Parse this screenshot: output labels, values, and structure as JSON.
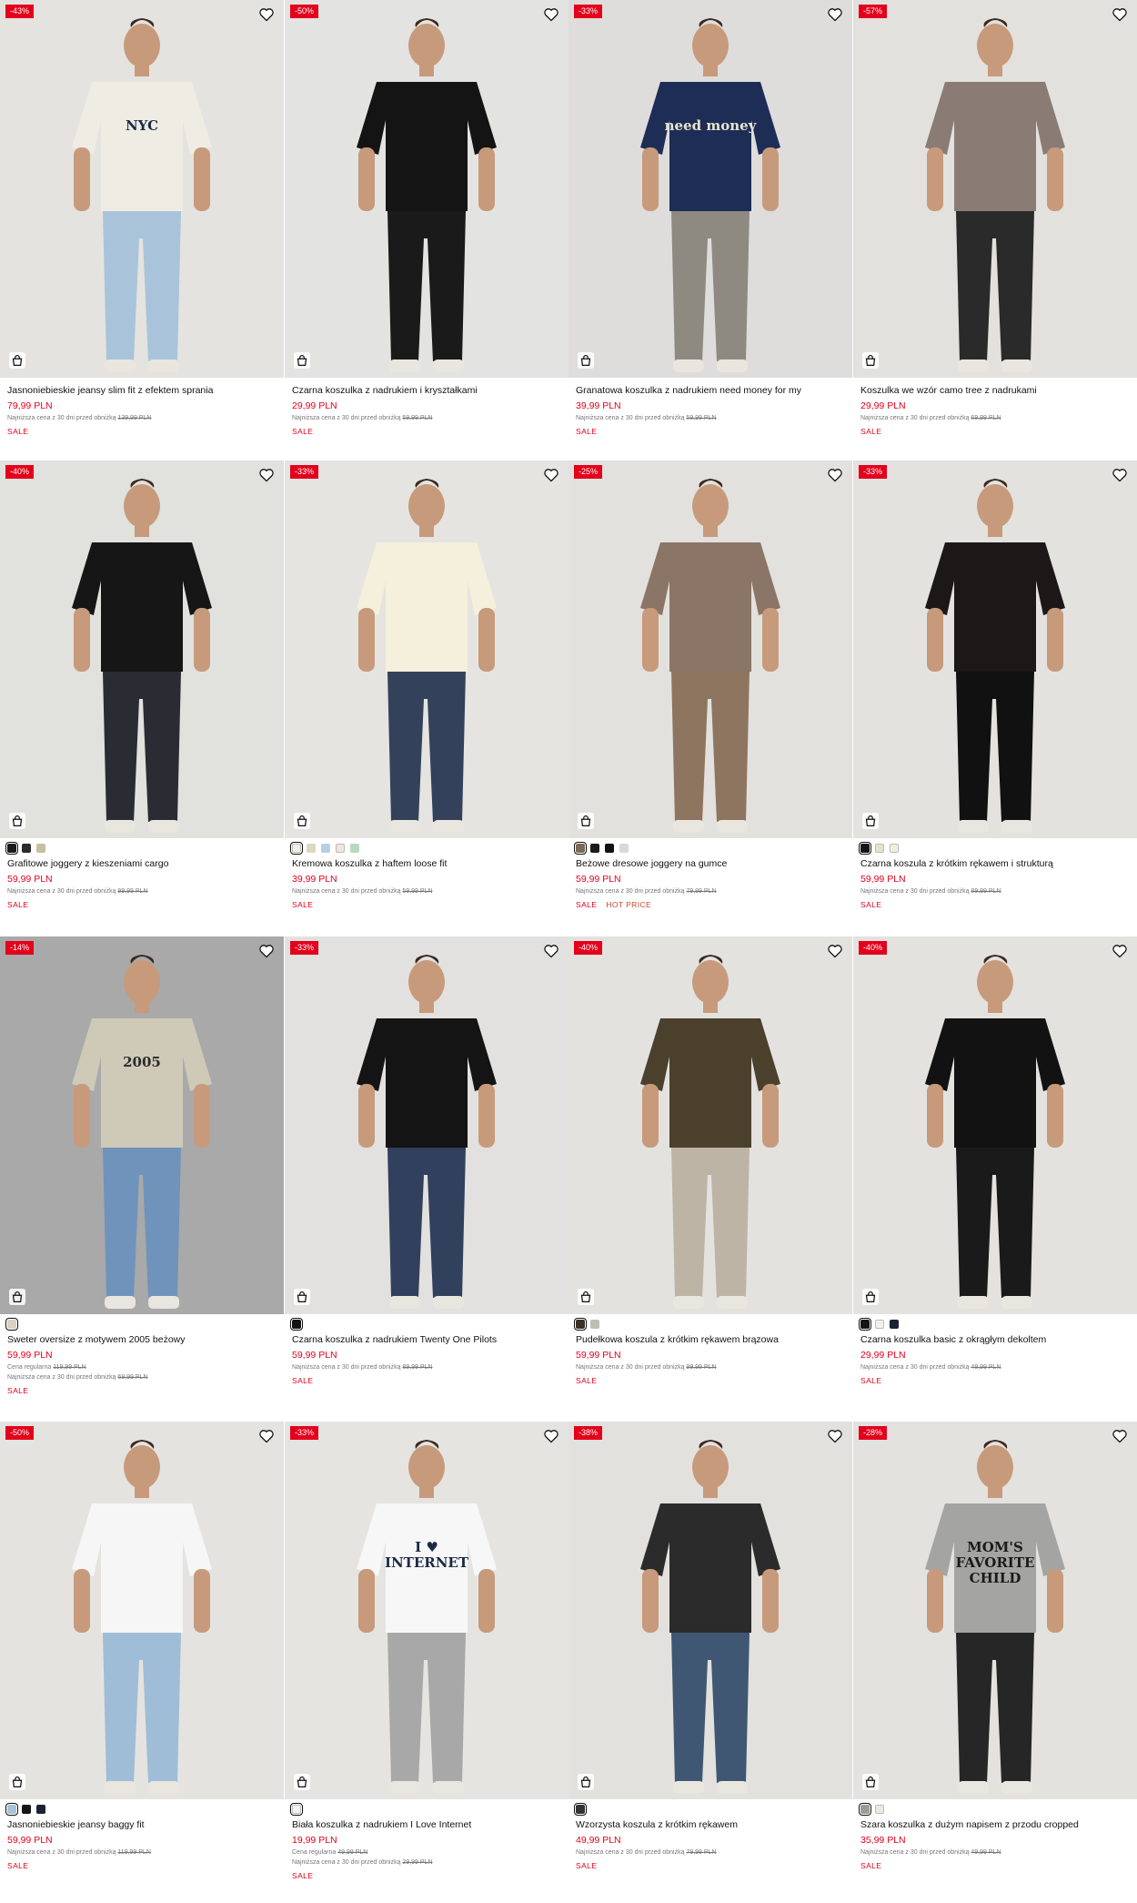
{
  "products": [
    {
      "discount": "-43%",
      "name": "Jasnoniebieskie jeansy slim fit z efektem sprania",
      "price": "79,99 PLN",
      "notes": [
        {
          "text": "Najniższa cena z 30 dni przed obniżką",
          "old": "139,99 PLN"
        }
      ],
      "tags": [
        "SALE"
      ],
      "swatches": [],
      "bg": "#e4e3df",
      "top": "#efece3",
      "bottom": "#a9c4da",
      "print": "NYC"
    },
    {
      "discount": "-50%",
      "name": "Czarna koszulka z nadrukiem i kryształkami",
      "price": "29,99 PLN",
      "notes": [
        {
          "text": "Najniższa cena z 30 dni przed obniżką",
          "old": "59,99 PLN"
        }
      ],
      "tags": [
        "SALE"
      ],
      "swatches": [],
      "bg": "#e3e3e1",
      "top": "#141414",
      "bottom": "#1a1a1a",
      "print": ""
    },
    {
      "discount": "-33%",
      "name": "Granatowa koszulka z nadrukiem need money for my",
      "price": "39,99 PLN",
      "notes": [
        {
          "text": "Najniższa cena z 30 dni przed obniżką",
          "old": "59,99 PLN"
        }
      ],
      "tags": [
        "SALE"
      ],
      "swatches": [],
      "bg": "#dedddb",
      "top": "#1d2d55",
      "bottom": "#8e8a82",
      "print": "need money"
    },
    {
      "discount": "-57%",
      "name": "Koszulka we wzór camo tree z nadrukami",
      "price": "29,99 PLN",
      "notes": [
        {
          "text": "Najniższa cena z 30 dni przed obniżką",
          "old": "69,99 PLN"
        }
      ],
      "tags": [
        "SALE"
      ],
      "swatches": [],
      "bg": "#e2e1dd",
      "top": "#8a7c75",
      "bottom": "#2a2a2a",
      "print": ""
    },
    {
      "discount": "-40%",
      "name": "Grafitowe joggery z kieszeniami cargo",
      "price": "59,99 PLN",
      "notes": [
        {
          "text": "Najniższa cena z 30 dni przed obniżką",
          "old": "99,99 PLN"
        }
      ],
      "tags": [
        "SALE"
      ],
      "swatches": [
        "#1a1a1a",
        "#2a2a2a",
        "#c8bfa0"
      ],
      "bg": "#e1e1de",
      "top": "#161616",
      "bottom": "#2b2b33",
      "print": ""
    },
    {
      "discount": "-33%",
      "name": "Kremowa koszulka z haftem loose fit",
      "price": "39,99 PLN",
      "notes": [
        {
          "text": "Najniższa cena z 30 dni przed obniżką",
          "old": "59,99 PLN"
        }
      ],
      "tags": [
        "SALE"
      ],
      "swatches": [
        "#f1eee4",
        "#ded8c2",
        "#b9cfe0",
        "#f2e4de",
        "#b8d8c0"
      ],
      "bg": "#e6e4e0",
      "top": "#f4f0dc",
      "bottom": "#33415b",
      "print": ""
    },
    {
      "discount": "-25%",
      "name": "Beżowe dresowe joggery na gumce",
      "price": "59,99 PLN",
      "notes": [
        {
          "text": "Najniższa cena z 30 dni przed obniżką",
          "old": "79,99 PLN"
        }
      ],
      "tags": [
        "SALE",
        "HOT PRICE"
      ],
      "swatches": [
        "#7a6a5a",
        "#1a1a1a",
        "#111111",
        "#d8d8d8"
      ],
      "bg": "#e2e1dd",
      "top": "#8b7566",
      "bottom": "#8e7560",
      "print": ""
    },
    {
      "discount": "-33%",
      "name": "Czarna koszula z krótkim rękawem i strukturą",
      "price": "59,99 PLN",
      "notes": [
        {
          "text": "Najniższa cena z 30 dni przed obniżką",
          "old": "89,99 PLN"
        }
      ],
      "tags": [
        "SALE"
      ],
      "swatches": [
        "#141414",
        "#e8e2cc",
        "#f2eedc"
      ],
      "bg": "#e3e2df",
      "top": "#1b1817",
      "bottom": "#111111",
      "print": ""
    },
    {
      "discount": "-14%",
      "name": "Sweter oversize z motywem 2005 beżowy",
      "price": "59,99 PLN",
      "notes": [
        {
          "text": "Cena regularna",
          "old": "119,99 PLN"
        },
        {
          "text": "Najniższa cena z 30 dni przed obniżką",
          "old": "69,99 PLN"
        }
      ],
      "tags": [
        "SALE"
      ],
      "swatches": [
        "#d8d2c0"
      ],
      "bg": "#a9a9a9",
      "top": "#cfc9b8",
      "bottom": "#6f93bb",
      "print": "2005"
    },
    {
      "discount": "-33%",
      "name": "Czarna koszulka z nadrukiem Twenty One Pilots",
      "price": "59,99 PLN",
      "notes": [
        {
          "text": "Najniższa cena z 30 dni przed obniżką",
          "old": "89,99 PLN"
        }
      ],
      "tags": [
        "SALE"
      ],
      "swatches": [
        "#141414"
      ],
      "bg": "#e2e1df",
      "top": "#141414",
      "bottom": "#31405c",
      "print": ""
    },
    {
      "discount": "-40%",
      "name": "Pudełkowa koszula z krótkim rękawem brązowa",
      "price": "59,99 PLN",
      "notes": [
        {
          "text": "Najniższa cena z 30 dni przed obniżką",
          "old": "99,99 PLN"
        }
      ],
      "tags": [
        "SALE"
      ],
      "swatches": [
        "#3a3226",
        "#bdbdb2"
      ],
      "bg": "#e3e2df",
      "top": "#4a402c",
      "bottom": "#bdb4a6",
      "print": ""
    },
    {
      "discount": "-40%",
      "name": "Czarna koszulka basic z okrągłym dekoltem",
      "price": "29,99 PLN",
      "notes": [
        {
          "text": "Najniższa cena z 30 dni przed obniżką",
          "old": "49,99 PLN"
        }
      ],
      "tags": [
        "SALE"
      ],
      "swatches": [
        "#141414",
        "#f0f0f0",
        "#1b2233"
      ],
      "bg": "#e3e2df",
      "top": "#121212",
      "bottom": "#1a1a1a",
      "print": ""
    },
    {
      "discount": "-50%",
      "name": "Jasnoniebieskie jeansy baggy fit",
      "price": "59,99 PLN",
      "notes": [
        {
          "text": "Najniższa cena z 30 dni przed obniżką",
          "old": "119,99 PLN"
        }
      ],
      "tags": [
        "SALE"
      ],
      "swatches": [
        "#a7c2d9",
        "#141414",
        "#1b2233"
      ],
      "bg": "#e4e3e0",
      "top": "#f6f6f6",
      "bottom": "#9fbdd6",
      "print": ""
    },
    {
      "discount": "-33%",
      "name": "Biała koszulka z nadrukiem I Love Internet",
      "price": "19,99 PLN",
      "notes": [
        {
          "text": "Cena regularna",
          "old": "49,99 PLN"
        },
        {
          "text": "Najniższa cena z 30 dni przed obniżką",
          "old": "29,99 PLN"
        }
      ],
      "tags": [
        "SALE"
      ],
      "swatches": [
        "#f3f3f3"
      ],
      "bg": "#e5e4e1",
      "top": "#f7f7f7",
      "bottom": "#a8a8a8",
      "print": "I ♥ INTERNET"
    },
    {
      "discount": "-38%",
      "name": "Wzorzysta koszula z krótkim rękawem",
      "price": "49,99 PLN",
      "notes": [
        {
          "text": "Najniższa cena z 30 dni przed obniżką",
          "old": "79,99 PLN"
        }
      ],
      "tags": [
        "SALE"
      ],
      "swatches": [
        "#333333"
      ],
      "bg": "#e2e1de",
      "top": "#2b2b2b",
      "bottom": "#3f5772",
      "print": ""
    },
    {
      "discount": "-28%",
      "name": "Szara koszulka z dużym napisem z przodu cropped",
      "price": "35,99 PLN",
      "notes": [
        {
          "text": "Najniższa cena z 30 dni przed obniżką",
          "old": "49,99 PLN"
        }
      ],
      "tags": [
        "SALE"
      ],
      "swatches": [
        "#9a9a98",
        "#ece8dc"
      ],
      "bg": "#e3e2df",
      "top": "#a4a4a2",
      "bottom": "#262626",
      "print": "MOM'S FAVORITE CHILD"
    }
  ]
}
